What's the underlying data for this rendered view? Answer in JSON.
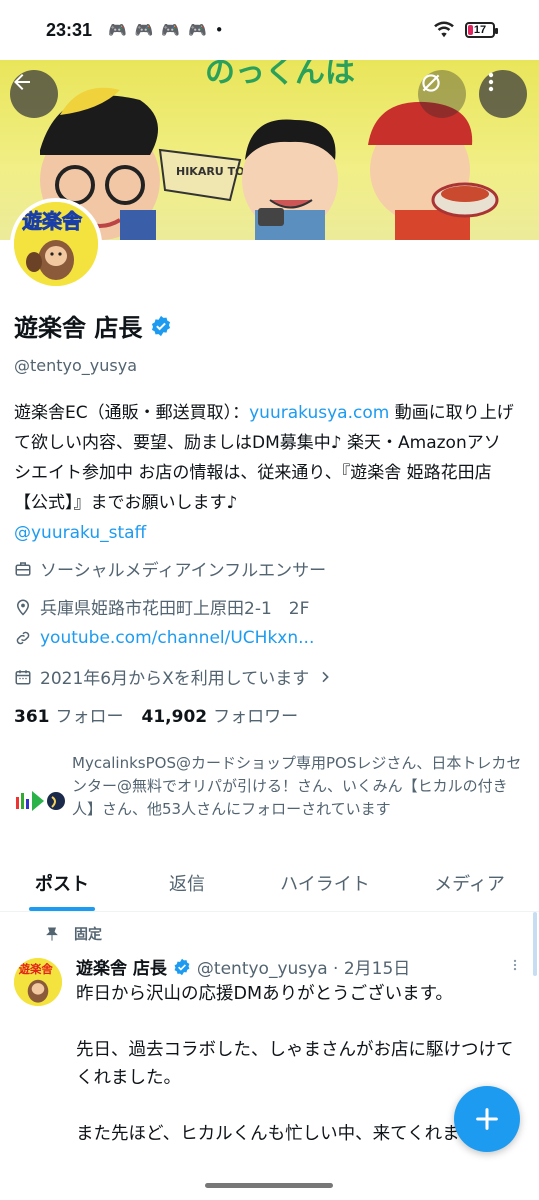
{
  "status_bar": {
    "time": "23:31",
    "dot": "•",
    "battery": "17"
  },
  "banner": {
    "sign": "HIKARU TOURS",
    "tagline": "のっくんは"
  },
  "profile": {
    "name": "遊楽舎 店長",
    "handle": "@tentyo_yusya",
    "bio_1": "遊楽舎EC（通販・郵送買取）：",
    "bio_link": "yuurakusya.com",
    "bio_2": " 動画に取り上げて欲しい内容、要望、励ましはDM募集中♪ 楽天・Amazonアソシエイト参加中 お店の情報は、従来通り、『遊楽舎 姫路花田店【公式】』までお願いします♪ ",
    "bio_mention": "@yuuraku_staff",
    "category": "ソーシャルメディアインフルエンサー",
    "location": "兵庫県姫路市花田町上原田2-1　2F",
    "website": "youtube.com/channel/UCHkxn...",
    "joined": "2021年6月からXを利用しています",
    "following_count": "361",
    "following_label": "フォロー",
    "followers_count": "41,902",
    "followers_label": "フォロワー",
    "followed_by": "MycalinksPOS@カードショップ専用POSレジさん、日本トレカセンター@無料でオリパが引ける！さん、いくみん【ヒカルの付き人】さん、他53人さんにフォローされています"
  },
  "tabs": [
    "ポスト",
    "返信",
    "ハイライト",
    "メディア"
  ],
  "pinned_post": {
    "pinned_label": "固定",
    "name": "遊楽舎 店長",
    "meta": "@tentyo_yusya · 2月15日",
    "body": "昨日から沢山の応援DMありがとうございます。\n\n先日、過去コラボした、しゃまさんがお店に駆けつけてくれました。\n\nまた先ほど、ヒカルくんも忙しい中、来てくれました。"
  },
  "colors": {
    "accent": "#1d9bf0",
    "banner": "#e9e55a",
    "text": "#0f1419",
    "muted": "#536471"
  },
  "icons": [
    "back-arrow-icon",
    "refresh-icon",
    "more-vertical-icon",
    "verified-badge-icon",
    "briefcase-icon",
    "location-pin-icon",
    "link-icon",
    "calendar-icon",
    "chevron-right-icon",
    "pin-icon",
    "compose-plus-icon",
    "wifi-icon"
  ]
}
